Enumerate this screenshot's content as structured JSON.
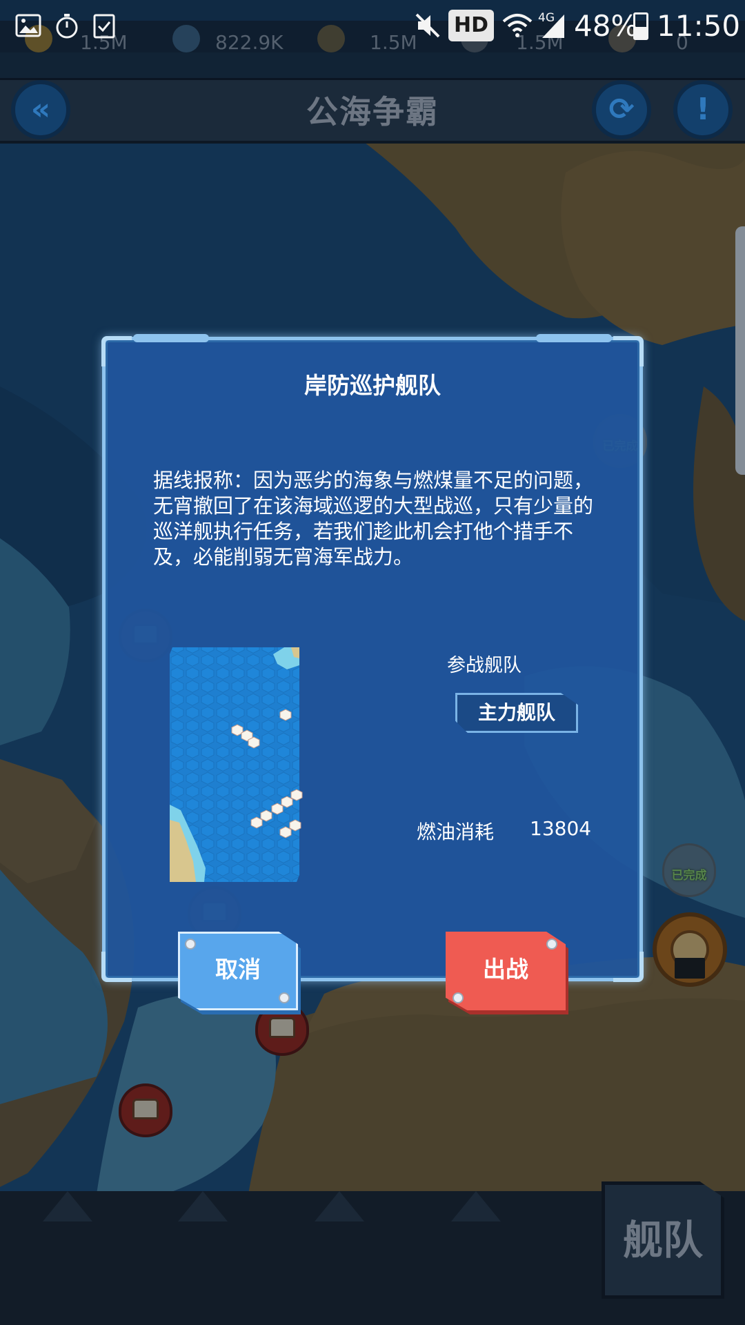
{
  "status_bar": {
    "network": "4G",
    "hd": "HD",
    "battery": "48%",
    "time": "11:50"
  },
  "resources": [
    {
      "name": "gold",
      "value": "1.5M"
    },
    {
      "name": "fuel",
      "value": "822.9K"
    },
    {
      "name": "ammo",
      "value": "1.5M"
    },
    {
      "name": "steel",
      "value": "1.5M"
    },
    {
      "name": "special",
      "value": "0"
    }
  ],
  "header": {
    "title": "公海争霸",
    "back_icon": "double-chevron-left-icon",
    "refresh_icon": "refresh-icon",
    "info_icon": "exclamation-icon"
  },
  "map": {
    "done_label": "已完成"
  },
  "dialog": {
    "title": "岸防巡护舰队",
    "description": "据线报称：因为恶劣的海象与燃煤量不足的问题，无宵撤回了在该海域巡逻的大型战巡，只有少量的巡洋舰执行任务，若我们趁此机会打他个措手不及，必能削弱无宵海军战力。",
    "fleet_label": "参战舰队",
    "fleet_value": "主力舰队",
    "fuel_label": "燃油消耗",
    "fuel_value": "13804",
    "cancel_label": "取消",
    "sortie_label": "出战"
  },
  "bottom_nav": {
    "fleet_label": "舰队"
  },
  "colors": {
    "dialog_bg": "#20569e",
    "dialog_border": "#8ec3ee",
    "cancel": "#58a6ec",
    "sortie": "#ef5b52"
  }
}
